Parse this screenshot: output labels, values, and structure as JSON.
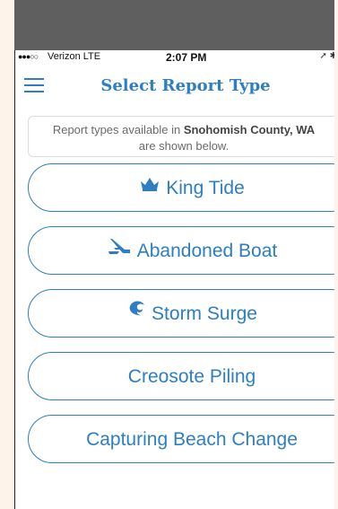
{
  "status_bar": {
    "signal": "●●●○○",
    "carrier": "Verizon  LTE",
    "time": "2:07 PM",
    "icons": "➚ ✱"
  },
  "nav": {
    "title": "Select Report Type"
  },
  "info": {
    "prefix": "Report types available in ",
    "location": "Snohomish County, WA",
    "suffix": "are shown below."
  },
  "report_types": [
    {
      "label": "King Tide",
      "icon": "crown-icon"
    },
    {
      "label": "Abandoned Boat",
      "icon": "sinking-boat-icon"
    },
    {
      "label": "Storm Surge",
      "icon": "wave-icon"
    },
    {
      "label": "Creosote Piling",
      "icon": ""
    },
    {
      "label": "Capturing Beach Change",
      "icon": ""
    }
  ],
  "colors": {
    "accent": "#2d7ec2",
    "frame_top": "#5f5f5f",
    "frame_side": "#fdf3ea"
  }
}
